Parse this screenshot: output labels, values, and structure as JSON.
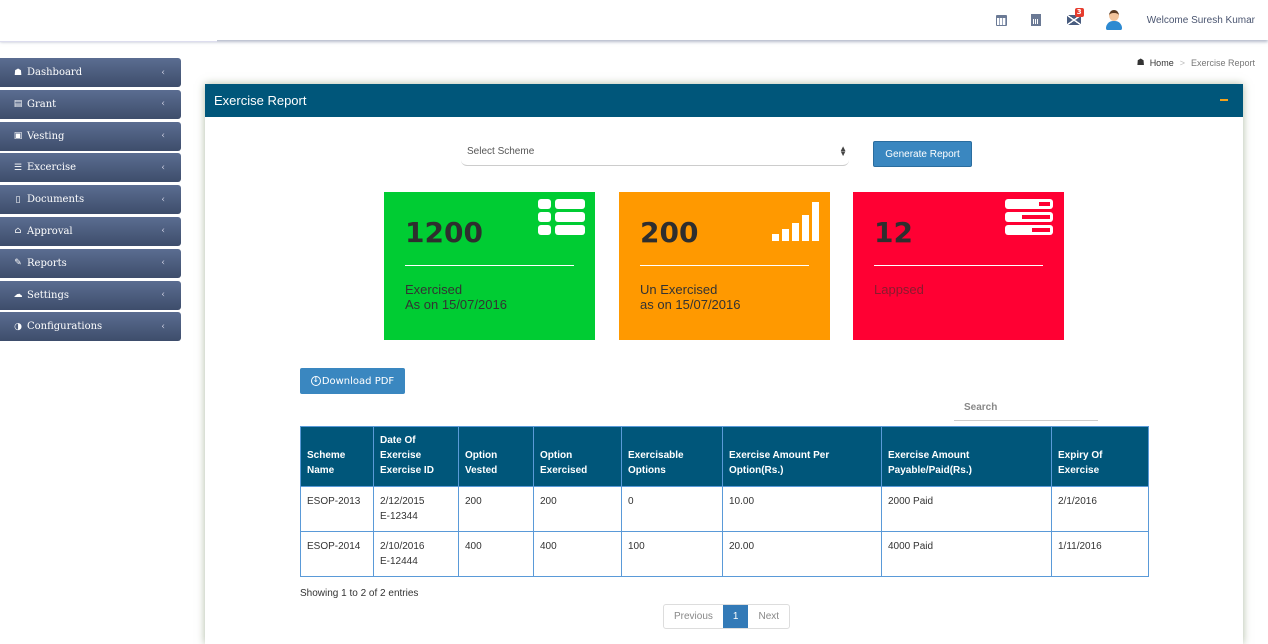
{
  "header": {
    "mail_badge": "3",
    "welcome_text": "Welcome Suresh Kumar",
    "icons": [
      "calendar-icon",
      "calculator-icon",
      "mail-icon",
      "user-avatar"
    ]
  },
  "sidebar": {
    "items": [
      {
        "label": "Dashboard",
        "icon": "dashboard-icon",
        "glyph": "☗"
      },
      {
        "label": "Grant",
        "icon": "file-icon",
        "glyph": "▤"
      },
      {
        "label": "Vesting",
        "icon": "money-icon",
        "glyph": "▣"
      },
      {
        "label": "Excercise",
        "icon": "tasks-icon",
        "glyph": "☰"
      },
      {
        "label": "Documents",
        "icon": "document-icon",
        "glyph": "▯"
      },
      {
        "label": "Approval",
        "icon": "bank-icon",
        "glyph": "⌂"
      },
      {
        "label": "Reports",
        "icon": "paperclip-icon",
        "glyph": "✎"
      },
      {
        "label": "Settings",
        "icon": "cloud-chart-icon",
        "glyph": "☁"
      },
      {
        "label": "Configurations",
        "icon": "adjust-icon",
        "glyph": "◑"
      }
    ],
    "chevron": "‹"
  },
  "breadcrumb": {
    "home": "Home",
    "separator": ">",
    "current": "Exercise Report"
  },
  "panel": {
    "title": "Exercise Report",
    "scheme_select": {
      "selected": "Select Scheme"
    },
    "generate_button": "Generate Report",
    "cards": [
      {
        "value": "1200",
        "line1": "Exercised",
        "line2": "As on 15/07/2016",
        "color": "#00cc33",
        "icon": "list-icon"
      },
      {
        "value": "200",
        "line1": "Un Exercised",
        "line2": "as on 15/07/2016",
        "color": "#ff9900",
        "icon": "signal-bars-icon"
      },
      {
        "value": "12",
        "line1": "Lappsed",
        "line2": "",
        "color": "#ff0033",
        "icon": "progress-list-icon"
      }
    ],
    "download_button": "Download PDF",
    "search_placeholder": "Search",
    "table": {
      "headers": [
        [
          "Scheme",
          "Name"
        ],
        [
          "Date Of",
          "Exercise",
          "Exercise ID"
        ],
        [
          "Option",
          "Vested"
        ],
        [
          "Option",
          "Exercised"
        ],
        [
          "Exercisable",
          "Options"
        ],
        [
          "Exercise Amount Per",
          "Option(Rs.)"
        ],
        [
          "Exercise Amount",
          "Payable/Paid(Rs.)"
        ],
        [
          "Expiry Of",
          "Exercise"
        ]
      ],
      "rows": [
        {
          "scheme": "ESOP-2013",
          "date": "2/12/2015",
          "exercise_id": "E-12344",
          "vested": "200",
          "exercised": "200",
          "exercisable": "0",
          "amount_per_option": "10.00",
          "amount_payable": "2000 Paid",
          "expiry": "2/1/2016"
        },
        {
          "scheme": "ESOP-2014",
          "date": "2/10/2016",
          "exercise_id": "E-12444",
          "vested": "400",
          "exercised": "400",
          "exercisable": "100",
          "amount_per_option": "20.00",
          "amount_payable": "4000 Paid",
          "expiry": "1/11/2016"
        }
      ]
    },
    "info": "Showing 1 to 2 of 2 entries",
    "pagination": {
      "previous": "Previous",
      "current_page": "1",
      "next": "Next"
    }
  }
}
